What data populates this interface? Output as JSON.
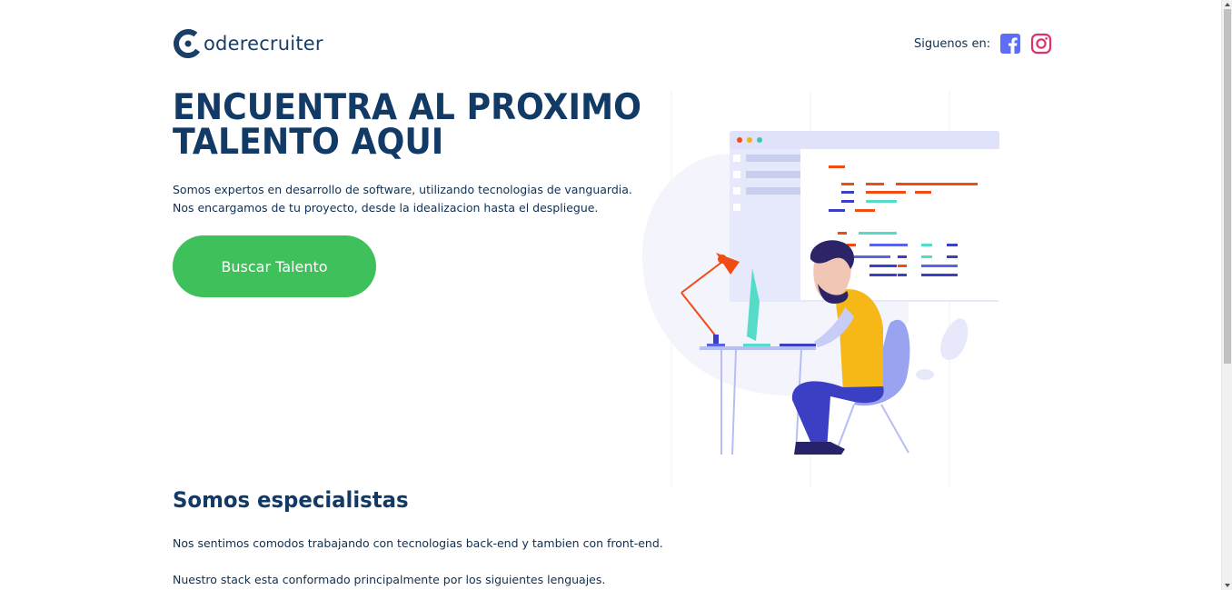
{
  "header": {
    "logo_text": "oderecruiter",
    "social_label": "Siguenos en:",
    "social_icons": [
      "facebook-icon",
      "instagram-icon"
    ]
  },
  "hero": {
    "title_line1": "ENCUENTRA AL PROXIMO",
    "title_line2": "TALENTO AQUI",
    "desc_line1": "Somos expertos en desarrollo de software, utilizando tecnologias de vanguardia.",
    "desc_line2": "Nos encargamos de tu proyecto, desde la idealizacion hasta el despliegue.",
    "cta_label": "Buscar Talento"
  },
  "specialists": {
    "title": "Somos especialistas",
    "p1": "Nos sentimos comodos trabajando con tecnologias back-end y tambien con front-end.",
    "p2": "Nuestro stack esta conformado principalmente por los siguientes lenguajes."
  },
  "colors": {
    "primary": "#123a66",
    "accent_green": "#3ec05a",
    "facebook": "#5b6ef5",
    "instagram": "#e1306c"
  }
}
